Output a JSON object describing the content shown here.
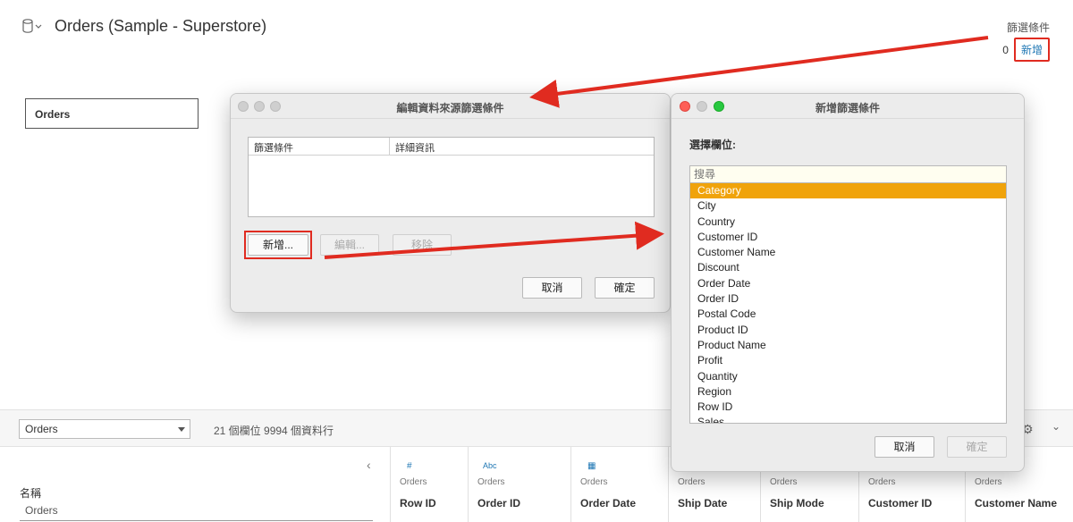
{
  "header": {
    "title": "Orders (Sample - Superstore)",
    "filters_label": "篩選條件",
    "filters_count": "0",
    "filters_add": "新增"
  },
  "canvas": {
    "table_name": "Orders"
  },
  "bottom_bar": {
    "table_select": "Orders",
    "fields_info": "21 個欄位 9994 個資料行",
    "name_header": "名稱",
    "name_value": "Orders"
  },
  "grid": {
    "columns": [
      {
        "icon": "#",
        "source": "Orders",
        "name": "Row ID"
      },
      {
        "icon": "Abc",
        "source": "Orders",
        "name": "Order ID"
      },
      {
        "icon": "▦",
        "source": "Orders",
        "name": "Order Date"
      },
      {
        "icon": "",
        "source": "Orders",
        "name": "Ship Date"
      },
      {
        "icon": "",
        "source": "Orders",
        "name": "Ship Mode"
      },
      {
        "icon": "",
        "source": "Orders",
        "name": "Customer ID"
      },
      {
        "icon": "",
        "source": "Orders",
        "name": "Customer Name"
      }
    ]
  },
  "edit_dialog": {
    "title": "編輯資料來源篩選條件",
    "col_filter": "篩選條件",
    "col_details": "詳細資訊",
    "add_button": "新增...",
    "edit_button": "編輯...",
    "remove_button": "移除",
    "cancel_button": "取消",
    "ok_button": "確定"
  },
  "add_dialog": {
    "title": "新增篩選條件",
    "choose_label": "選擇欄位:",
    "search_placeholder": "搜尋",
    "fields": [
      "Category",
      "City",
      "Country",
      "Customer ID",
      "Customer Name",
      "Discount",
      "Order Date",
      "Order ID",
      "Postal Code",
      "Product ID",
      "Product Name",
      "Profit",
      "Quantity",
      "Region",
      "Row ID",
      "Sales"
    ],
    "selected_field": "Category",
    "cancel_button": "取消",
    "ok_button": "確定"
  },
  "colors": {
    "accent_selected": "#f0a30a",
    "annotation_red": "#e02b20",
    "link_blue": "#1f77b4"
  }
}
